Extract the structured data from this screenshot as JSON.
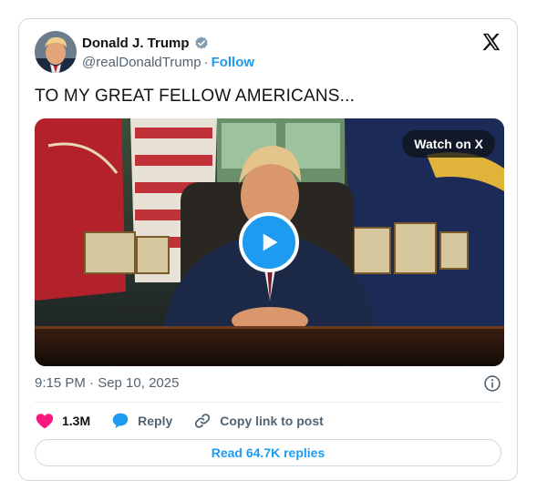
{
  "author": {
    "name": "Donald J. Trump",
    "handle": "@realDonaldTrump",
    "separator": "·",
    "follow_label": "Follow",
    "verified_icon": "verified-badge-icon",
    "verified_color": "#829aab"
  },
  "tweet": {
    "text": "TO MY GREAT FELLOW AMERICANS...",
    "timestamp": "9:15 PM · Sep 10, 2025"
  },
  "media": {
    "watch_label": "Watch on X",
    "play_icon": "play-icon"
  },
  "actions": {
    "likes_count": "1.3M",
    "reply_label": "Reply",
    "copy_link_label": "Copy link to post"
  },
  "footer": {
    "replies_label": "Read 64.7K replies"
  },
  "colors": {
    "accent": "#1d9bf0",
    "like": "#f91880",
    "muted": "#536471",
    "text": "#0f1419",
    "border": "#cfd9de"
  }
}
